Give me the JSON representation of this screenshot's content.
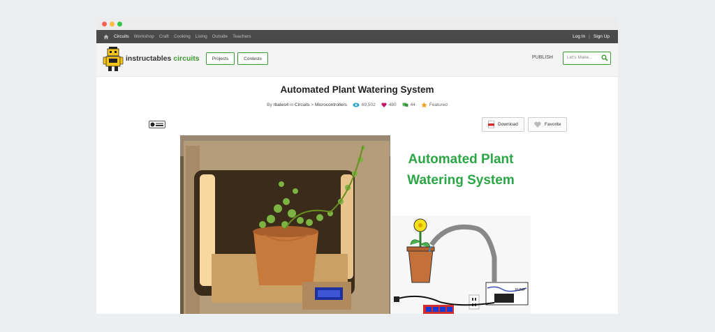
{
  "nav": {
    "items": [
      {
        "label": "Circuits",
        "active": true
      },
      {
        "label": "Workshop",
        "active": false
      },
      {
        "label": "Craft",
        "active": false
      },
      {
        "label": "Cooking",
        "active": false
      },
      {
        "label": "Living",
        "active": false
      },
      {
        "label": "Outside",
        "active": false
      },
      {
        "label": "Teachers",
        "active": false
      }
    ],
    "login": "Log In",
    "separator": "|",
    "signup": "Sign Up"
  },
  "header": {
    "brand_main": "instructables",
    "brand_sub": "circuits",
    "projects_label": "Projects",
    "contests_label": "Contests",
    "publish_label": "PUBLISH",
    "search_placeholder": "Let's Make..."
  },
  "article": {
    "title": "Automated Plant Watering System",
    "by": "By",
    "author": "rbates4",
    "in": "in",
    "category": "Circuits",
    "arrow": ">",
    "subcategory": "Microcontrollers",
    "views": "69,502",
    "favorites": "480",
    "comments": "44",
    "featured": "Featured",
    "download_label": "Download",
    "favorite_label": "Favorite"
  },
  "diagram": {
    "title_line1": "Automated Plant",
    "title_line2": "Watering System",
    "pump_label": "PUMP"
  },
  "colors": {
    "accent_green": "#3a9a2f",
    "nav_bg": "#4a4a4a",
    "diagram_title": "#2ba644"
  }
}
